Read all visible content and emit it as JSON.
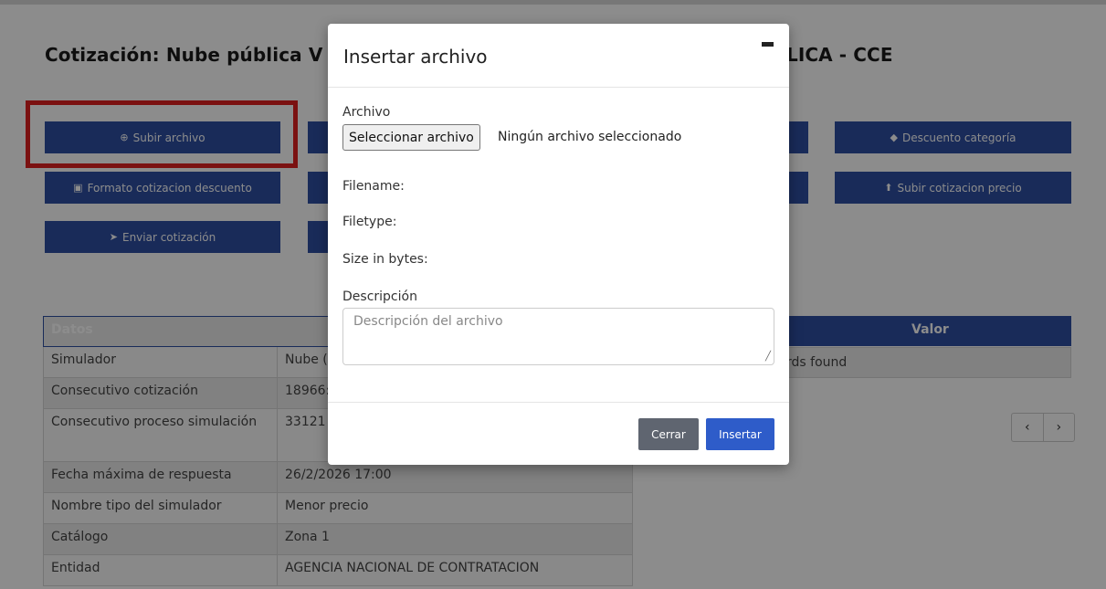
{
  "page": {
    "title": "Cotización: Nube pública V - ACUERDO MARCO DE PRECIOS ... PÚBLICA - CCE",
    "title_visible": "Cotización: Nube pública V -",
    "title_suffix": "LICA - CCE"
  },
  "toolbar": {
    "upload_file": {
      "label": "Subir archivo",
      "icon": "plus-circle-icon"
    },
    "category_discount": {
      "label": "Descuento categoría",
      "icon": "tag-icon"
    },
    "discount_format": {
      "label": "Formato cotizacion descuento",
      "icon": "file-icon"
    },
    "upload_price_quote": {
      "label": "Subir cotizacion precio",
      "icon": "upload-icon"
    },
    "send_quote": {
      "label": "Enviar cotización",
      "icon": "paper-plane-icon"
    }
  },
  "details_table": {
    "header": "Datos",
    "rows": [
      {
        "label": "Simulador",
        "value": "Nube ("
      },
      {
        "label": "Consecutivo cotización",
        "value": "18966:"
      },
      {
        "label": "Consecutivo proceso simulación",
        "value": "33121"
      },
      {
        "label": "Fecha máxima de respuesta",
        "value": "26/2/2026 17:00"
      },
      {
        "label": "Nombre tipo del simulador",
        "value": "Menor precio"
      },
      {
        "label": "Catálogo",
        "value": "Zona 1"
      },
      {
        "label": "Entidad",
        "value": "AGENCIA NACIONAL DE CONTRATACION"
      }
    ]
  },
  "right_table": {
    "header": "Valor",
    "empty_text": "rds found"
  },
  "pager": {
    "prev": "‹",
    "next": "›"
  },
  "modal": {
    "title": "Insertar archivo",
    "file_label": "Archivo",
    "file_button": "Seleccionar archivo",
    "file_status": "Ningún archivo seleccionado",
    "filename_label": "Filename:",
    "filetype_label": "Filetype:",
    "size_label": "Size in bytes:",
    "description_label": "Descripción",
    "description_placeholder": "Descripción del archivo",
    "close_button": "Cerrar",
    "insert_button": "Insertar"
  },
  "colors": {
    "primary": "#2e4fa3",
    "highlight": "#e02020",
    "close_button": "#5f6570",
    "insert_button": "#2e5cc9"
  }
}
